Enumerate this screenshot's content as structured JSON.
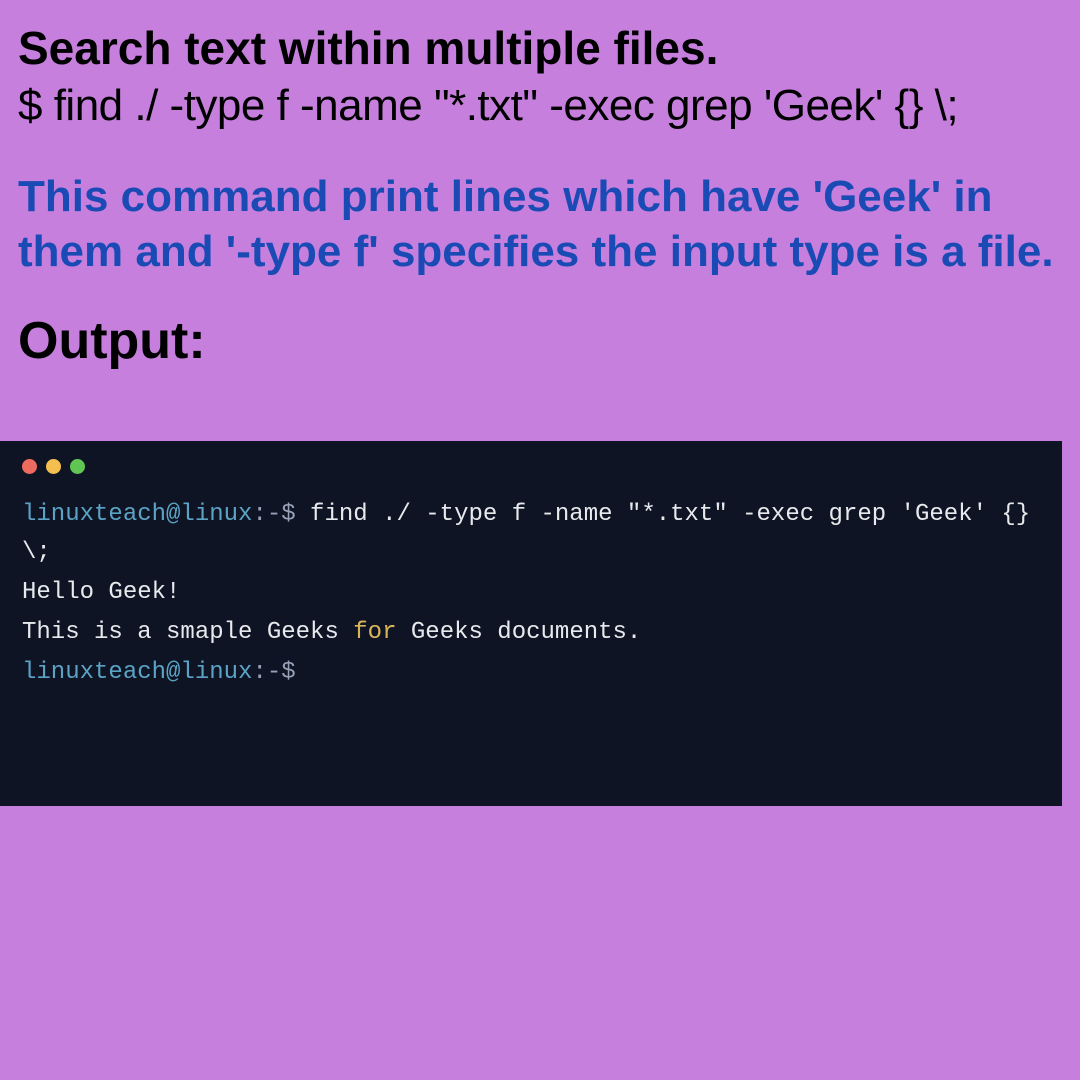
{
  "title": "Search text within multiple files.",
  "command": " $ find ./ -type f -name \"*.txt\" -exec grep 'Geek'  {} \\;",
  "description": "This command print lines which have 'Geek' in them and '-type f' specifies the input type is a file.",
  "output_label": "Output:",
  "terminal": {
    "line1_user": "linuxteach@linux",
    "line1_sep": ":-$",
    "line1_cmd": " find ./ -type f -name \"*.txt\" -exec grep 'Geek'  {} \\;",
    "line2": "Hello Geek!",
    "line3_pre": "This is a smaple Geeks ",
    "line3_kw": "for",
    "line3_post": " Geeks documents.",
    "line4_user": "linuxteach@linux",
    "line4_sep": ":-$"
  }
}
